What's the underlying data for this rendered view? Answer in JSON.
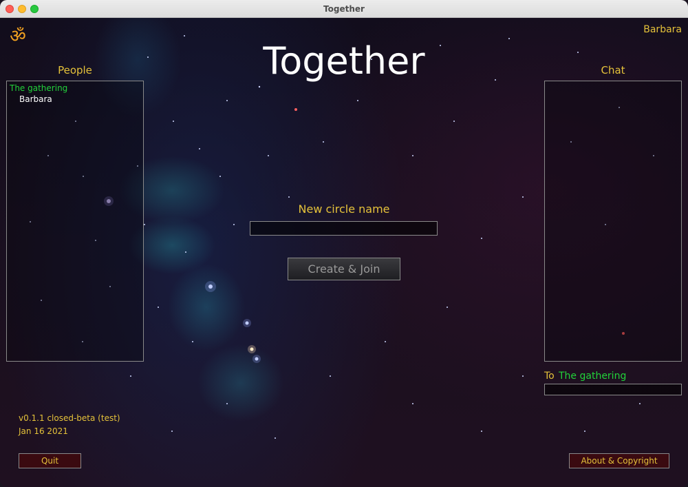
{
  "window": {
    "title": "Together"
  },
  "header": {
    "logo_icon": "om-icon",
    "logo_glyph": "ॐ",
    "app_title": "Together",
    "current_user": "Barbara"
  },
  "people": {
    "label": "People",
    "circles": [
      {
        "name": "The gathering",
        "members": [
          "Barbara"
        ]
      }
    ]
  },
  "new_circle": {
    "label": "New circle name",
    "value": "",
    "button_label": "Create & Join"
  },
  "chat": {
    "label": "Chat",
    "to_prefix": "To",
    "to_target": "The gathering",
    "input_value": ""
  },
  "footer": {
    "version": "v0.1.1 closed-beta (test)",
    "date": "Jan 16 2021",
    "quit_label": "Quit",
    "about_label": "About & Copyright"
  },
  "colors": {
    "accent": "#e5c23a",
    "circle_green": "#22d23a",
    "button_bg": "#3a0a10"
  }
}
